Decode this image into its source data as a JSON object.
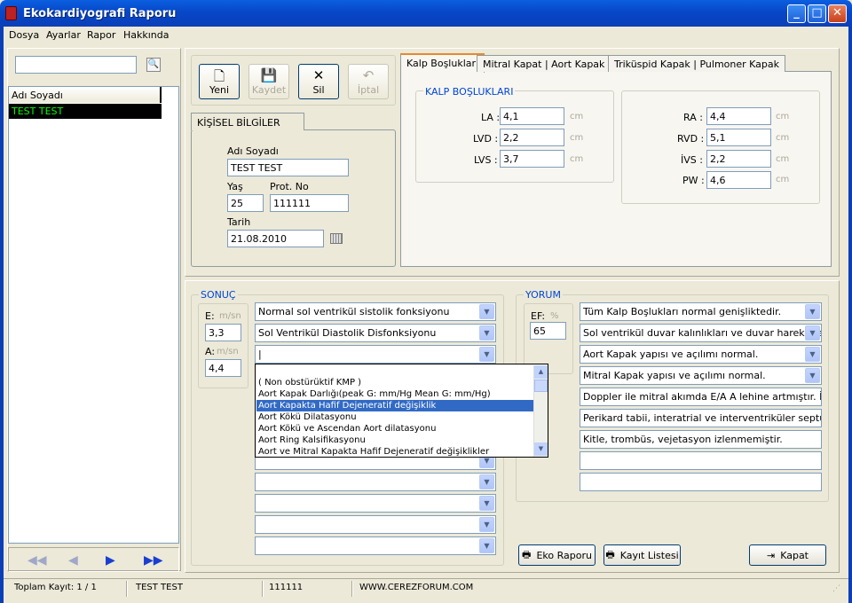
{
  "window": {
    "title": "Ekokardiyografi Raporu"
  },
  "menu": [
    "Dosya",
    "Ayarlar",
    "Rapor",
    "Hakkında"
  ],
  "list": {
    "header": "Adı Soyadı",
    "rows": [
      "TEST TEST"
    ],
    "search_value": ""
  },
  "toolbar": {
    "new": "Yeni",
    "save": "Kaydet",
    "delete": "Sil",
    "cancel": "İptal"
  },
  "personal": {
    "tab": "KİŞİSEL BİLGİLER",
    "name_label": "Adı Soyadı",
    "name_value": "TEST TEST",
    "age_label": "Yaş",
    "age_value": "25",
    "prot_label": "Prot. No",
    "prot_value": "111111",
    "date_label": "Tarih",
    "date_value": "21.08.2010"
  },
  "tabs": [
    "Kalp Boşlukları",
    "Mitral Kapat  |  Aort Kapak",
    "Triküspid Kapak  |  Pulmoner Kapak"
  ],
  "cavities": {
    "title": "KALP BOŞLUKLARI",
    "unit": "cm",
    "left": [
      {
        "label": "LA :",
        "value": "4,1"
      },
      {
        "label": "LVD :",
        "value": "2,2"
      },
      {
        "label": "LVS :",
        "value": "3,7"
      }
    ],
    "right": [
      {
        "label": "RA :",
        "value": "4,4"
      },
      {
        "label": "RVD :",
        "value": "5,1"
      },
      {
        "label": "İVS :",
        "value": "2,2"
      },
      {
        "label": "PW :",
        "value": "4,6"
      }
    ]
  },
  "result": {
    "title": "SONUÇ",
    "e_label": "E:",
    "e_unit": "m/sn",
    "e_value": "3,3",
    "a_label": "A:",
    "a_unit": "m/sn",
    "a_value": "4,4",
    "combos": [
      "Normal sol ventrikül sistolik fonksiyonu",
      "Sol Ventrikül Diastolik Disfonksiyonu",
      "|"
    ],
    "dropdown": [
      "",
      "( Non obstürüktif KMP )",
      "Aort Kapak Darlığı(peak G:  mm/Hg Mean G:  mm/Hg)",
      "Aort Kapakta Hafif Dejeneratif değişiklik",
      "Aort Kökü Dilatasyonu",
      "Aort Kökü ve Ascendan Aort dilatasyonu",
      "Aort Ring Kalsifikasyonu",
      "Aort ve Mitral Kapakta Hafif Dejeneratif değişiklikler"
    ],
    "dropdown_selected": 3
  },
  "comment": {
    "title": "YORUM",
    "ef_label": "EF:",
    "ef_unit": "%",
    "ef_value": "65",
    "combos": [
      "Tüm Kalp Boşlukları normal genişliktedir.",
      "Sol ventrikül duvar kalınlıkları ve duvar hareketleri no",
      "Aort Kapak yapısı ve açılımı normal.",
      "Mitral Kapak yapısı ve açılımı normal."
    ],
    "texts": [
      "Doppler ile mitral akımda E/A A lehine artmıştır. İVRT ve",
      "Perikard tabii, interatrial ve interventriküler septumlar inta",
      "Kitle, trombüs, vejetasyon izlenmemiştir.",
      "",
      ""
    ]
  },
  "buttons": {
    "report": "Eko Raporu",
    "list": "Kayıt Listesi",
    "close": "Kapat"
  },
  "status": {
    "total": "Toplam Kayıt: 1 / 1",
    "name": "TEST TEST",
    "prot": "111111",
    "site": "WWW.CEREZFORUM.COM"
  }
}
